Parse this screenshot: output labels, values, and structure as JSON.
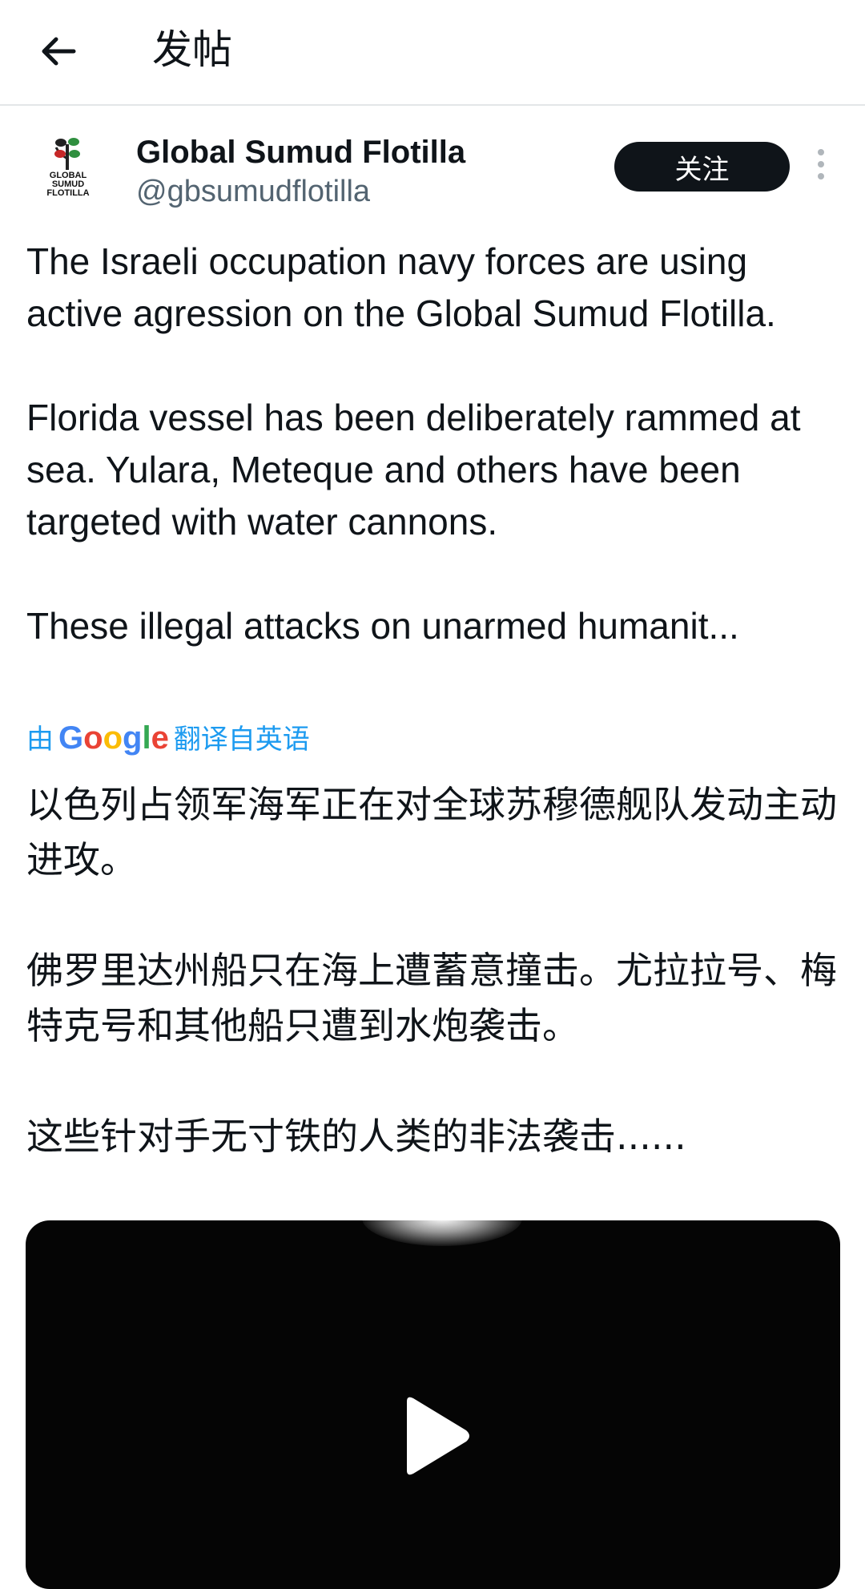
{
  "header": {
    "title": "发帖",
    "back_icon": "back-arrow-icon"
  },
  "author": {
    "name": "Global Sumud Flotilla",
    "handle": "@gbsumudflotilla",
    "avatar_lines": [
      "GLOBAL",
      "SUMUD",
      "FLOTILLA"
    ],
    "follow_label": "关注",
    "more_icon": "more-vertical-icon"
  },
  "tweet": {
    "paragraphs": [
      "The Israeli occupation navy forces are using active agression on the Global Sumud Flotilla.",
      "Florida vessel has been deliberately rammed at sea. Yulara, Meteque and others have been targeted with water cannons.",
      "These illegal attacks on unarmed humanit..."
    ]
  },
  "translation": {
    "prefix": "由",
    "brand": "Google",
    "suffix": "翻译自英语",
    "paragraphs": [
      "以色列占领军海军正在对全球苏穆德舰队发动主动进攻。",
      "佛罗里达州船只在海上遭蓄意撞击。尤拉拉号、梅特克号和其他船只遭到水炮袭击。",
      "这些针对手无寸铁的人类的非法袭击......"
    ]
  },
  "media": {
    "type": "video",
    "play_icon": "play-icon"
  },
  "colors": {
    "accent": "#1d9bf0",
    "text": "#0f1419",
    "secondary": "#536471",
    "follow_bg": "#0f1419"
  }
}
